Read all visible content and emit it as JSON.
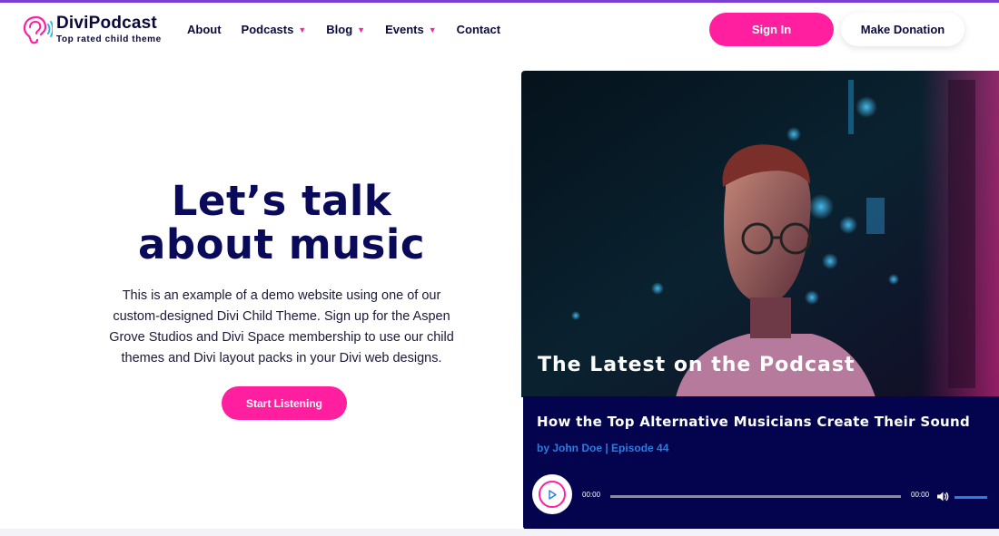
{
  "brand": {
    "name": "DiviPodcast",
    "tagline": "Top rated child theme",
    "accent": "#ff1f9f",
    "navy": "#03034e",
    "top_bar": "#7b3fd6"
  },
  "nav": {
    "items": [
      {
        "label": "About",
        "dropdown": false
      },
      {
        "label": "Podcasts",
        "dropdown": true
      },
      {
        "label": "Blog",
        "dropdown": true
      },
      {
        "label": "Events",
        "dropdown": true
      },
      {
        "label": "Contact",
        "dropdown": false
      }
    ],
    "dropdown_icon": "chevron-down-icon"
  },
  "header_buttons": {
    "sign_in": "Sign In",
    "donate": "Make Donation"
  },
  "hero": {
    "title_line1": "Let’s talk",
    "title_line2": "about music",
    "description": "This is an example of a demo website using one of our custom-designed Divi Child Theme. Sign up for the Aspen Grove Studios and Divi Space membership to use our child themes and Divi layout packs in your Divi web designs.",
    "cta": "Start Listening"
  },
  "podcast": {
    "caption": "The Latest on the Podcast",
    "episode_title": "How the Top Alternative Musicians Create Their Sound",
    "episode_meta": "by John Doe | Episode 44",
    "player": {
      "current_time": "00:00",
      "duration": "00:00",
      "progress": 0,
      "volume": 1.0,
      "play_icon": "play-icon",
      "volume_icon": "volume-icon"
    }
  }
}
